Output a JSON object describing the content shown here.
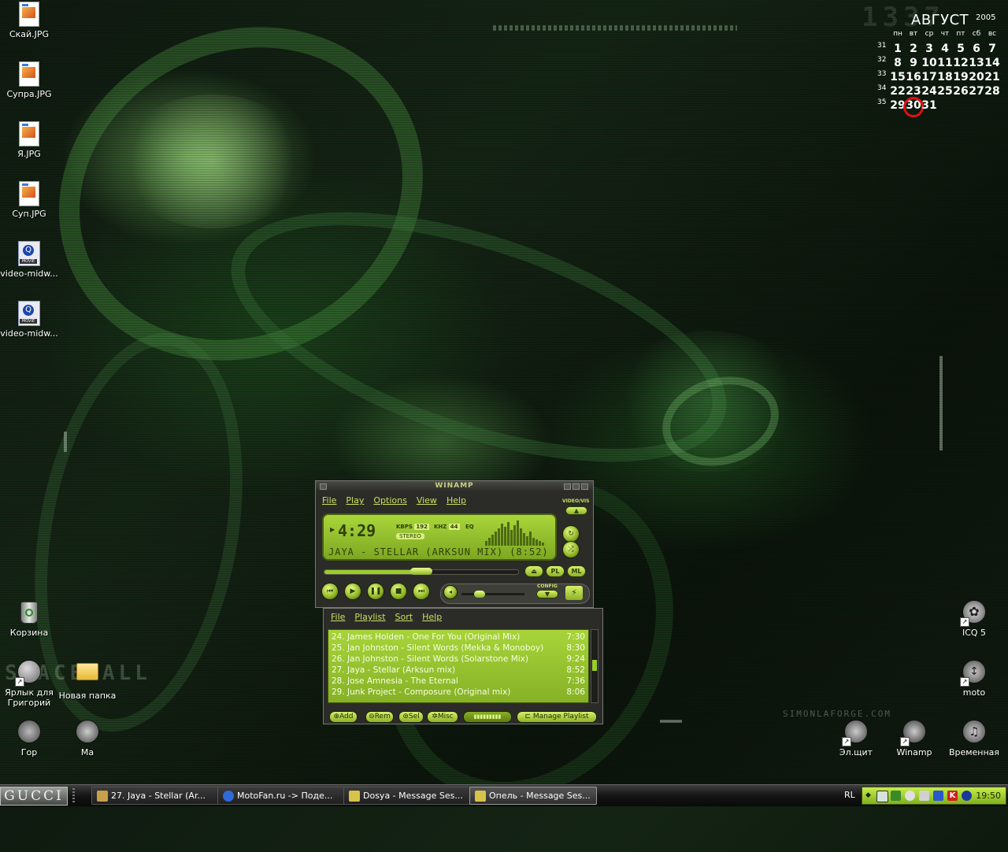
{
  "desktop": {
    "icons_left": [
      {
        "label": "Скай.JPG"
      },
      {
        "label": "Супра.JPG"
      },
      {
        "label": "Я.JPG"
      },
      {
        "label": "Суп.JPG"
      },
      {
        "label": "video-midw..."
      },
      {
        "label": "video-midw..."
      },
      {
        "label": "Корзина"
      },
      {
        "label": "Ярлык для Григорий"
      },
      {
        "label": "Новая папка"
      },
      {
        "label": "Гор"
      },
      {
        "label": "Ма"
      }
    ],
    "icons_right": [
      {
        "label": "ICQ 5"
      },
      {
        "label": "moto"
      },
      {
        "label": "Эл.щит"
      },
      {
        "label": "Winamp"
      },
      {
        "label": "Временная"
      }
    ],
    "wallpaper_text": {
      "logo": "SPACEBALL",
      "credit": "SIMONLAFORGE.COM",
      "big_number": "1337"
    }
  },
  "calendar": {
    "month": "АВГУСТ",
    "year": "2005",
    "weekdays": [
      "пн",
      "вт",
      "ср",
      "чт",
      "пт",
      "сб",
      "вс"
    ],
    "weeks": [
      {
        "num": "31",
        "days": [
          "",
          "1",
          "2",
          "3",
          "4",
          "5",
          "6",
          "7"
        ]
      },
      {
        "num": "32",
        "days": [
          "8",
          "9",
          "10",
          "11",
          "12",
          "13",
          "14"
        ]
      },
      {
        "num": "33",
        "days": [
          "15",
          "16",
          "17",
          "18",
          "19",
          "20",
          "21"
        ]
      },
      {
        "num": "34",
        "days": [
          "22",
          "23",
          "24",
          "25",
          "26",
          "27",
          "28"
        ]
      },
      {
        "num": "35",
        "days": [
          "29",
          "30",
          "31"
        ]
      }
    ],
    "today": "30"
  },
  "winamp": {
    "title": "WINAMP",
    "menu": [
      "File",
      "Play",
      "Options",
      "View",
      "Help"
    ],
    "video_vis": "VIDEO/VIS",
    "time": "4:29",
    "kbps_label": "KBPS",
    "kbps": "192",
    "khz_label": "KHZ",
    "khz": "44",
    "eq_label": "EQ",
    "stereo": "STEREO",
    "scroll_text": "JAYA - STELLAR (ARKSUN MIX) (8:52)",
    "seek_fraction": 0.5,
    "volume_fraction": 0.2,
    "side_buttons": [
      "PL",
      "ML"
    ],
    "config_label": "CONFIG"
  },
  "playlist": {
    "menu": [
      "File",
      "Playlist",
      "Sort",
      "Help"
    ],
    "items": [
      {
        "title": "24. James Holden - One For You (Original Mix)",
        "duration": "7:30"
      },
      {
        "title": "25. Jan Johnston - Silent Words (Mekka & Monoboy)",
        "duration": "8:30"
      },
      {
        "title": "26. Jan Johnston - Silent Words (Solarstone Mix)",
        "duration": "9:24"
      },
      {
        "title": "27. Jaya - Stellar (Arksun mix)",
        "duration": "8:52"
      },
      {
        "title": "28. Jose Amnesia - The Eternal",
        "duration": "7:36"
      },
      {
        "title": "29. Junk Project - Composure (Original mix)",
        "duration": "8:06"
      }
    ],
    "buttons": {
      "add": "Add",
      "rem": "Rem",
      "sel": "Sel",
      "misc": "Misc",
      "manage": "Manage Playlist"
    }
  },
  "taskbar": {
    "start_label": "GUCCI",
    "tasks": [
      {
        "label": "27. Jaya - Stellar (Ar...",
        "icon_color": "#c9a04a",
        "active": false
      },
      {
        "label": "MotoFan.ru -> Поде...",
        "icon_color": "#2f6ad8",
        "active": false
      },
      {
        "label": "Dosya - Message Ses...",
        "icon_color": "#d8c24a",
        "active": false
      },
      {
        "label": "Опель - Message Ses...",
        "icon_color": "#d8c24a",
        "active": true
      }
    ],
    "language": "RL",
    "clock": "19:50"
  },
  "colors": {
    "accent": "#9ccc2c",
    "today_ring": "#e01010",
    "desktop_dark": "#0f1a10"
  }
}
